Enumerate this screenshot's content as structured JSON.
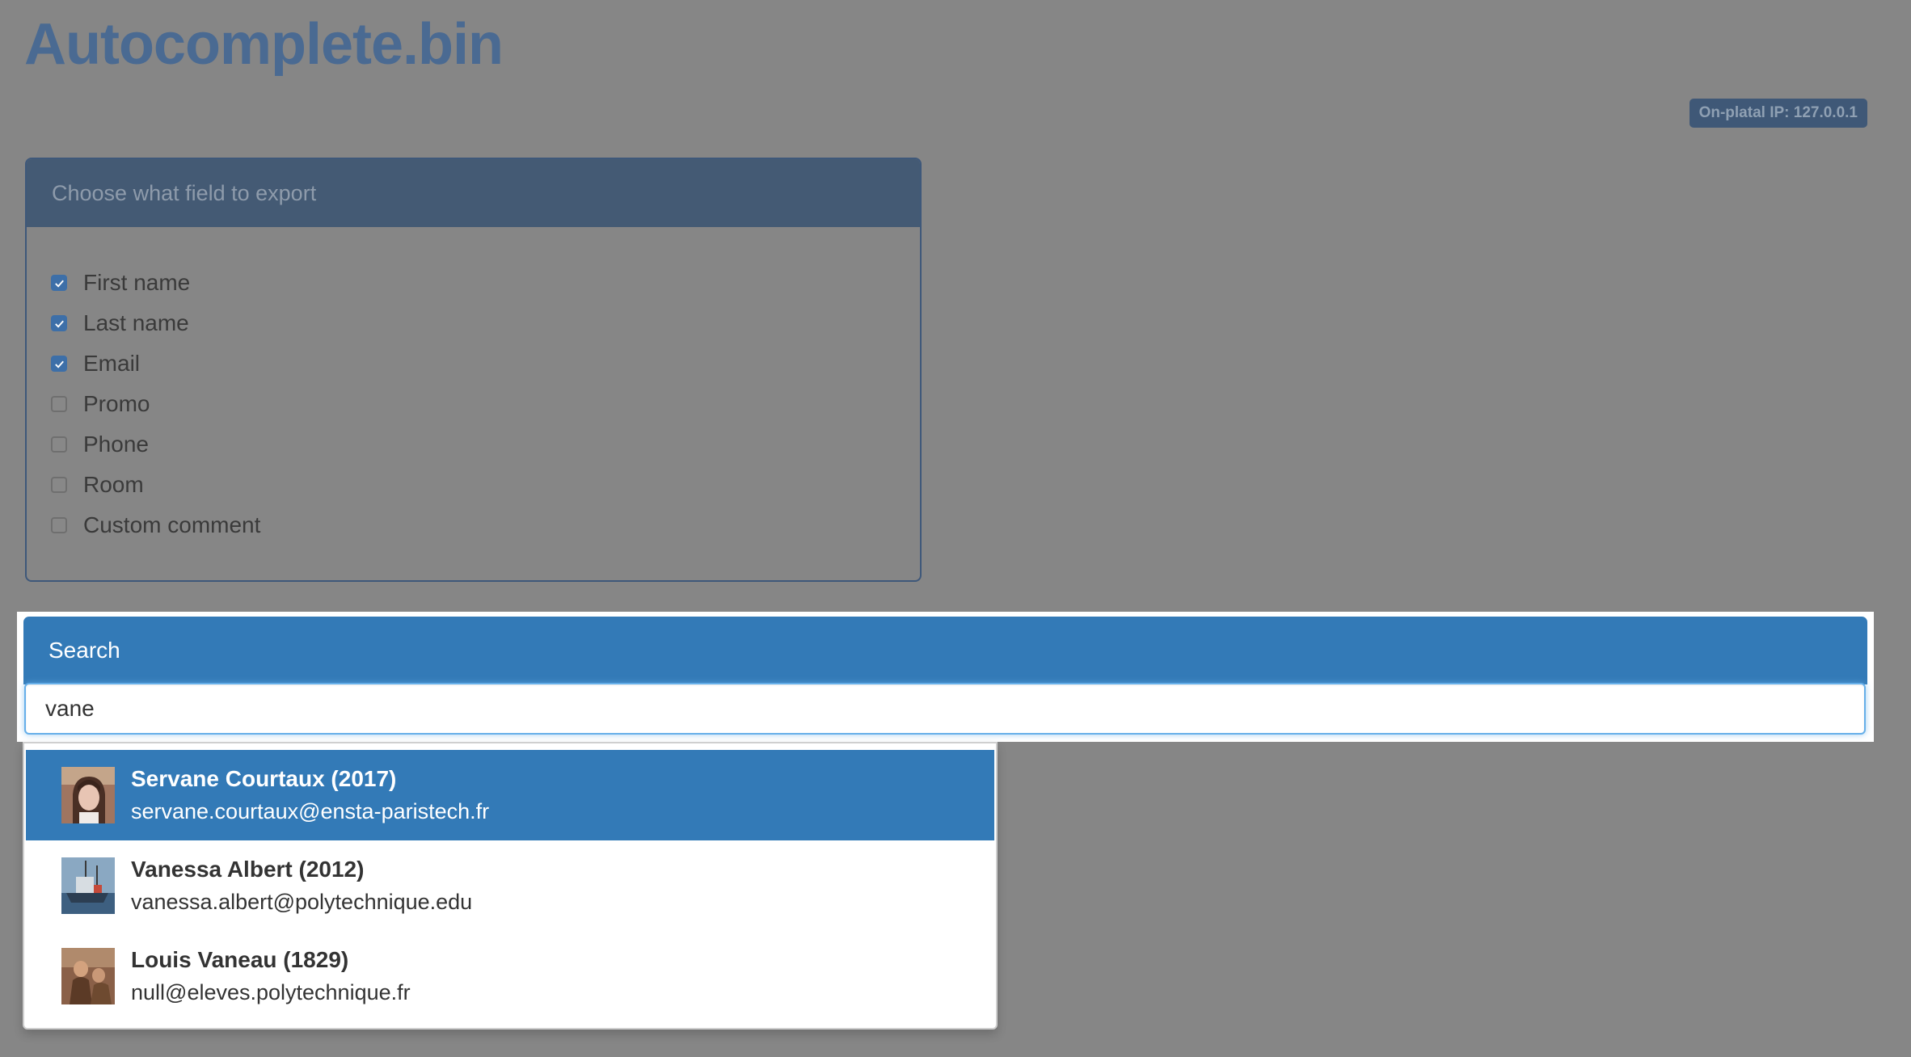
{
  "app": {
    "title": "Autocomplete.bin",
    "ip_badge": "On-platal IP: 127.0.0.1"
  },
  "export_panel": {
    "title": "Choose what field to export",
    "fields": [
      {
        "label": "First name",
        "checked": true
      },
      {
        "label": "Last name",
        "checked": true
      },
      {
        "label": "Email",
        "checked": true
      },
      {
        "label": "Promo",
        "checked": false
      },
      {
        "label": "Phone",
        "checked": false
      },
      {
        "label": "Room",
        "checked": false
      },
      {
        "label": "Custom comment",
        "checked": false
      }
    ]
  },
  "search": {
    "title": "Search",
    "query": "vane",
    "suggestions": [
      {
        "name": "Servane Courtaux (2017)",
        "email": "servane.courtaux@ensta-paristech.fr",
        "active": true
      },
      {
        "name": "Vanessa Albert (2012)",
        "email": "vanessa.albert@polytechnique.edu",
        "active": false
      },
      {
        "name": "Louis Vaneau (1829)",
        "email": "null@eleves.polytechnique.fr",
        "active": false
      }
    ]
  },
  "colors": {
    "accent": "#337ab7",
    "overlay": "#868686",
    "muted_header": "#445a74"
  }
}
